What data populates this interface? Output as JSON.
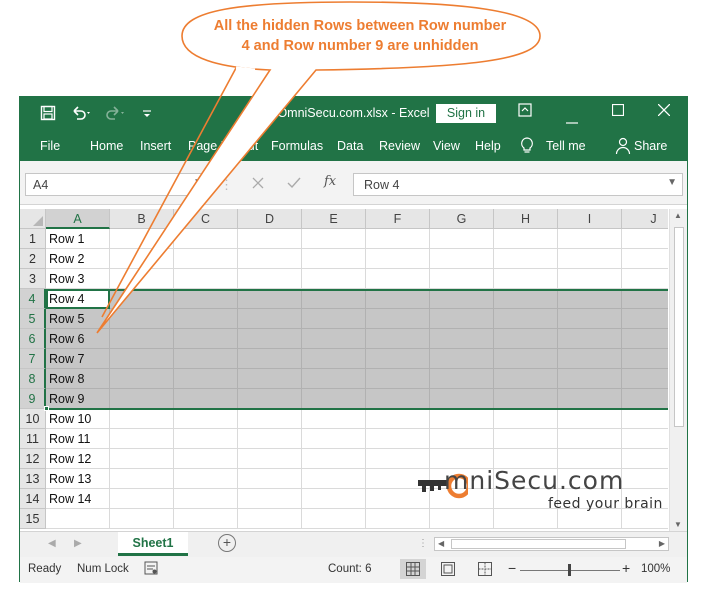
{
  "callout": {
    "line1": "All the hidden Rows between  Row number",
    "line2": "4 and Row number 9 are unhidden",
    "color": "#ed7d31"
  },
  "window": {
    "title": "OmniSecu.com.xlsx  -  Excel",
    "signin": "Sign in",
    "accent": "#217346",
    "icons": [
      "save-icon",
      "undo-icon",
      "redo-icon",
      "customize-icon"
    ]
  },
  "ribbon": {
    "tabs": [
      "File",
      "Home",
      "Insert",
      "Page Layout",
      "Formulas",
      "Data",
      "Review",
      "View",
      "Help"
    ],
    "tellme": "Tell me",
    "share": "Share"
  },
  "formula_bar": {
    "name_box": "A4",
    "content": "Row 4",
    "fx": "fx"
  },
  "grid": {
    "columns": [
      "A",
      "B",
      "C",
      "D",
      "E",
      "F",
      "G",
      "H",
      "I",
      "J"
    ],
    "rows": [
      "1",
      "2",
      "3",
      "4",
      "5",
      "6",
      "7",
      "8",
      "9",
      "10",
      "11",
      "12",
      "13",
      "14",
      "15"
    ],
    "values": [
      "Row 1",
      "Row 2",
      "Row 3",
      "Row 4",
      "Row 5",
      "Row 6",
      "Row 7",
      "Row 8",
      "Row 9",
      "Row 10",
      "Row 11",
      "Row 12",
      "Row 13",
      "Row 14",
      ""
    ],
    "selected_rows": [
      4,
      5,
      6,
      7,
      8,
      9
    ]
  },
  "sheets": {
    "active": "Sheet1",
    "add": "+"
  },
  "status": {
    "ready": "Ready",
    "numlock": "Num Lock",
    "count": "Count: 6",
    "zoom": "100%",
    "minus": "−",
    "plus": "+"
  },
  "logo": {
    "main": "mniSecu.com",
    "tag": "feed your brain"
  }
}
